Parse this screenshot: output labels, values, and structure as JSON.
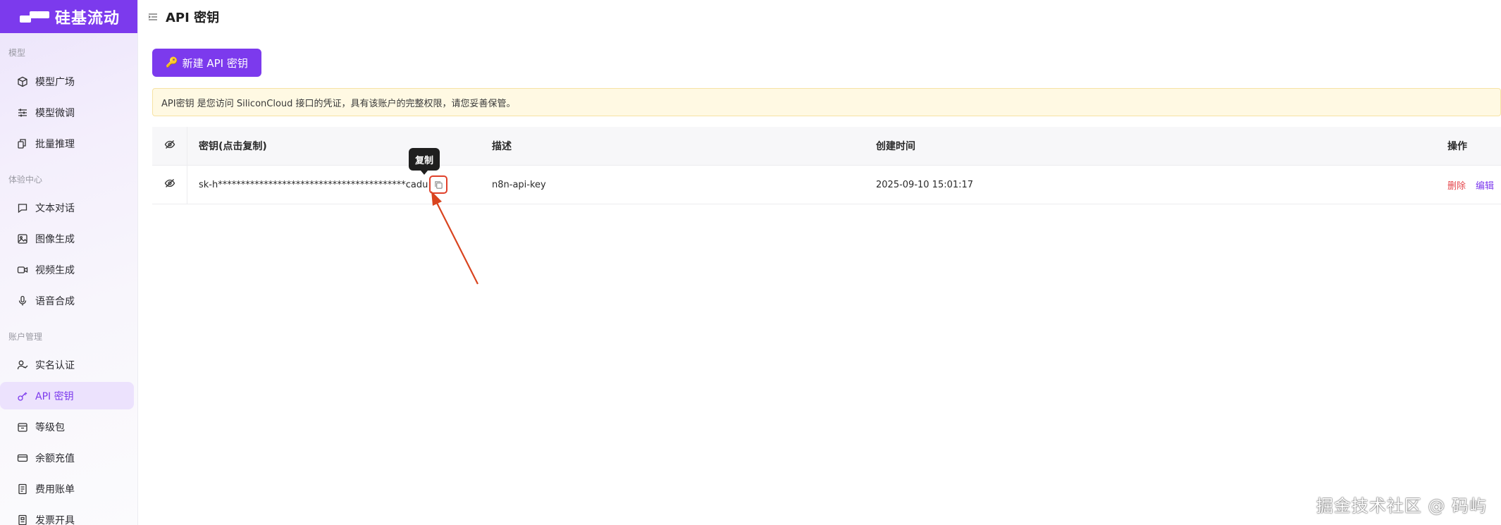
{
  "brand": {
    "name": "硅基流动",
    "color": "#7c3aed"
  },
  "header": {
    "title": "API 密钥"
  },
  "sidebar": {
    "sections": [
      {
        "title": "模型",
        "items": [
          {
            "label": "模型广场",
            "icon": "cube-icon"
          },
          {
            "label": "模型微调",
            "icon": "sliders-icon"
          },
          {
            "label": "批量推理",
            "icon": "batch-icon"
          }
        ]
      },
      {
        "title": "体验中心",
        "items": [
          {
            "label": "文本对话",
            "icon": "chat-icon"
          },
          {
            "label": "图像生成",
            "icon": "image-icon"
          },
          {
            "label": "视频生成",
            "icon": "video-icon"
          },
          {
            "label": "语音合成",
            "icon": "mic-icon"
          }
        ]
      },
      {
        "title": "账户管理",
        "items": [
          {
            "label": "实名认证",
            "icon": "user-check-icon"
          },
          {
            "label": "API 密钥",
            "icon": "key-icon",
            "active": true
          },
          {
            "label": "等级包",
            "icon": "package-icon"
          },
          {
            "label": "余额充值",
            "icon": "card-icon"
          },
          {
            "label": "费用账单",
            "icon": "bill-icon"
          },
          {
            "label": "发票开具",
            "icon": "invoice-icon"
          }
        ]
      }
    ]
  },
  "toolbar": {
    "new_key_label": "新建 API 密钥",
    "new_key_icon": "🔑"
  },
  "notice": {
    "text": "API密钥 是您访问 SiliconCloud 接口的凭证，具有该账户的完整权限，请您妥善保管。"
  },
  "table": {
    "columns": {
      "key": "密钥(点击复制)",
      "desc": "描述",
      "created": "创建时间",
      "actions": "操作"
    },
    "rows": [
      {
        "key": "sk-h*****************************************cadu",
        "desc": "n8n-api-key",
        "created": "2025-09-10 15:01:17",
        "delete_label": "删除",
        "edit_label": "编辑"
      }
    ]
  },
  "tooltip": {
    "text": "复制"
  },
  "watermark": {
    "text": "掘金技术社区 @ 码屿"
  },
  "colors": {
    "accent": "#7c3aed",
    "danger": "#e5484d",
    "notice_bg": "#fff9e3",
    "highlight": "#e0402a"
  }
}
